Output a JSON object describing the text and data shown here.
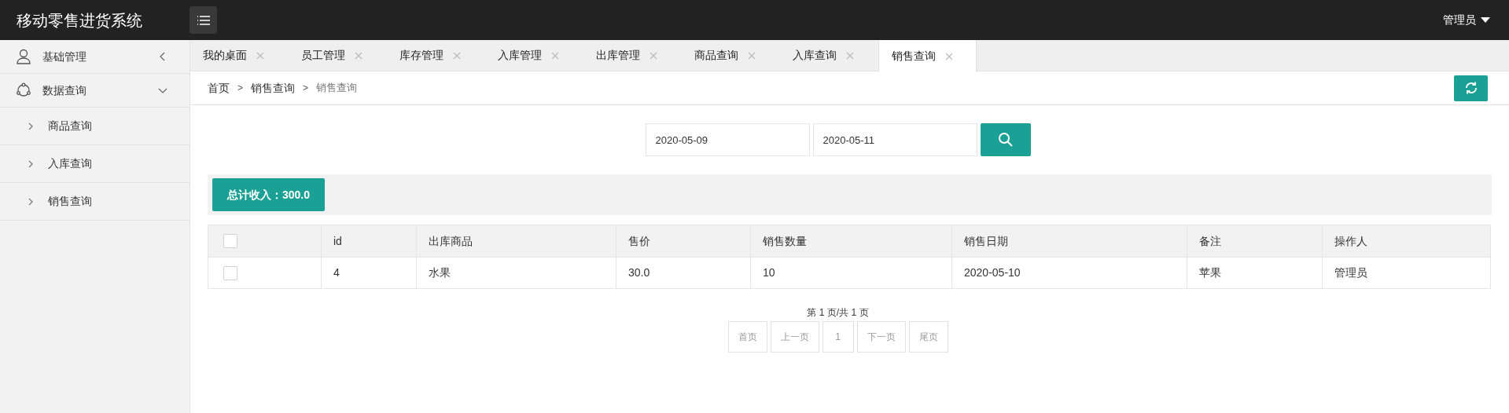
{
  "header": {
    "title": "移动零售进货系统",
    "user": "管理员"
  },
  "sidebar": {
    "items": [
      {
        "label": "基础管理",
        "kind": "user",
        "expanded": false
      },
      {
        "label": "数据查询",
        "kind": "data",
        "expanded": true,
        "children": [
          {
            "label": "商品查询",
            "selected": false
          },
          {
            "label": "入库查询",
            "selected": false
          },
          {
            "label": "销售查询",
            "selected": false
          }
        ]
      }
    ]
  },
  "tabs": [
    {
      "label": "我的桌面",
      "selected": false
    },
    {
      "label": "员工管理",
      "selected": false
    },
    {
      "label": "库存管理",
      "selected": false
    },
    {
      "label": "入库管理",
      "selected": false
    },
    {
      "label": "出库管理",
      "selected": false
    },
    {
      "label": "商品查询",
      "selected": false
    },
    {
      "label": "入库查询",
      "selected": false
    },
    {
      "label": "销售查询",
      "selected": true
    }
  ],
  "breadcrumb": {
    "separator": ">",
    "items": [
      "首页",
      "销售查询",
      "销售查询"
    ]
  },
  "search": {
    "start_date": "2020-05-09",
    "end_date": "2020-05-11"
  },
  "total": "总计收入：300.0",
  "table": {
    "columns": [
      "id",
      "出库商品",
      "售价",
      "销售数量",
      "销售日期",
      "备注",
      "操作人"
    ],
    "header_checked": false,
    "rows": [
      {
        "checked": false,
        "cells": [
          "4",
          "水果",
          "30.0",
          "10",
          "2020-05-10",
          "苹果",
          "管理员"
        ]
      }
    ]
  },
  "pagination": {
    "summary": "第 1 页/共 1 页",
    "buttons": [
      {
        "label": "首页",
        "disabled": true
      },
      {
        "label": "上一页",
        "disabled": true
      },
      {
        "label": "1",
        "disabled": true
      },
      {
        "label": "下一页",
        "disabled": true
      },
      {
        "label": "尾页",
        "disabled": true
      }
    ]
  }
}
